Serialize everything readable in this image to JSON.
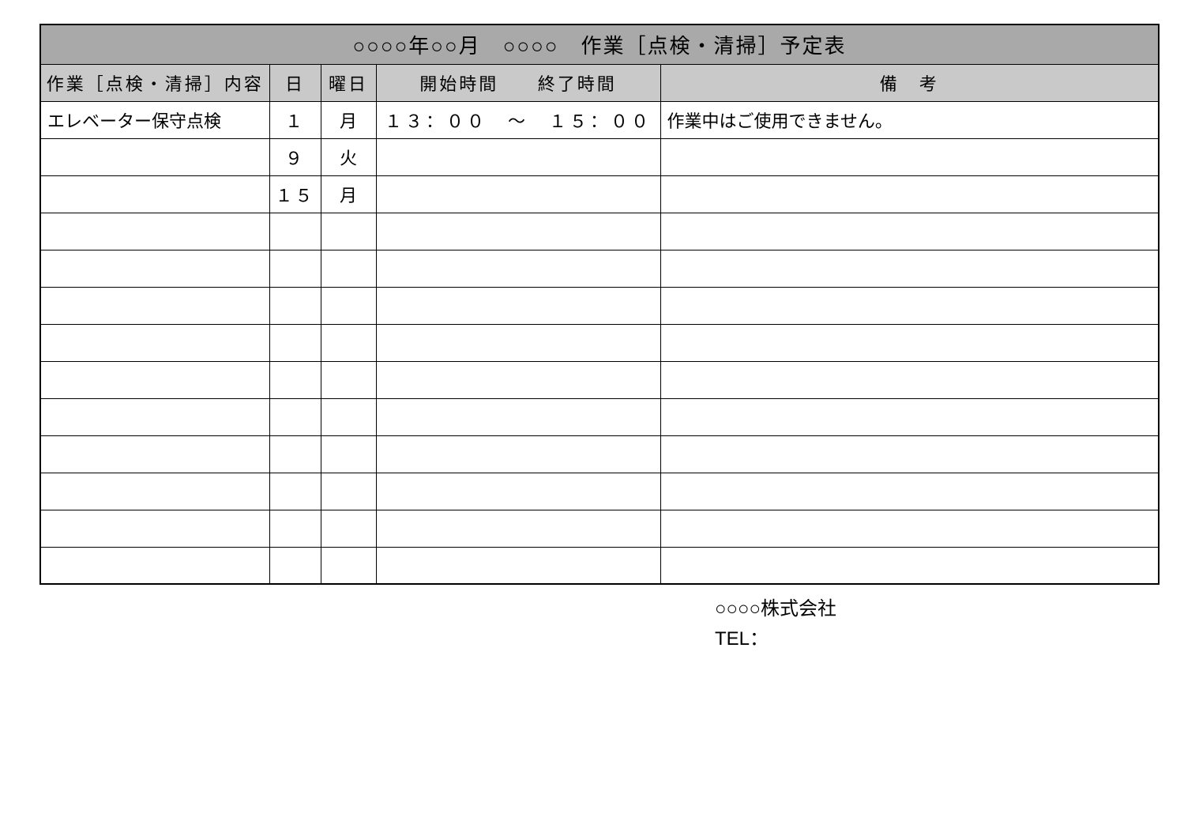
{
  "title": "○○○○年○○月　○○○○　作業［点検・清掃］予定表",
  "headers": {
    "task": "作業［点検・清掃］内容",
    "day": "日",
    "weekday": "曜日",
    "start_time": "開始時間",
    "end_time": "終了時間",
    "note": "備　考"
  },
  "rows": [
    {
      "task": "エレベーター保守点検",
      "day": "１",
      "weekday": "月",
      "time": "１３：００　～　１５：００",
      "note": "作業中はご使用できません。"
    },
    {
      "task": "",
      "day": "９",
      "weekday": "火",
      "time": "",
      "note": ""
    },
    {
      "task": "",
      "day": "１５",
      "weekday": "月",
      "time": "",
      "note": ""
    },
    {
      "task": "",
      "day": "",
      "weekday": "",
      "time": "",
      "note": ""
    },
    {
      "task": "",
      "day": "",
      "weekday": "",
      "time": "",
      "note": ""
    },
    {
      "task": "",
      "day": "",
      "weekday": "",
      "time": "",
      "note": ""
    },
    {
      "task": "",
      "day": "",
      "weekday": "",
      "time": "",
      "note": ""
    },
    {
      "task": "",
      "day": "",
      "weekday": "",
      "time": "",
      "note": ""
    },
    {
      "task": "",
      "day": "",
      "weekday": "",
      "time": "",
      "note": ""
    },
    {
      "task": "",
      "day": "",
      "weekday": "",
      "time": "",
      "note": ""
    },
    {
      "task": "",
      "day": "",
      "weekday": "",
      "time": "",
      "note": ""
    },
    {
      "task": "",
      "day": "",
      "weekday": "",
      "time": "",
      "note": ""
    },
    {
      "task": "",
      "day": "",
      "weekday": "",
      "time": "",
      "note": ""
    }
  ],
  "footer": {
    "company": "○○○○株式会社",
    "tel_label": "TEL："
  }
}
